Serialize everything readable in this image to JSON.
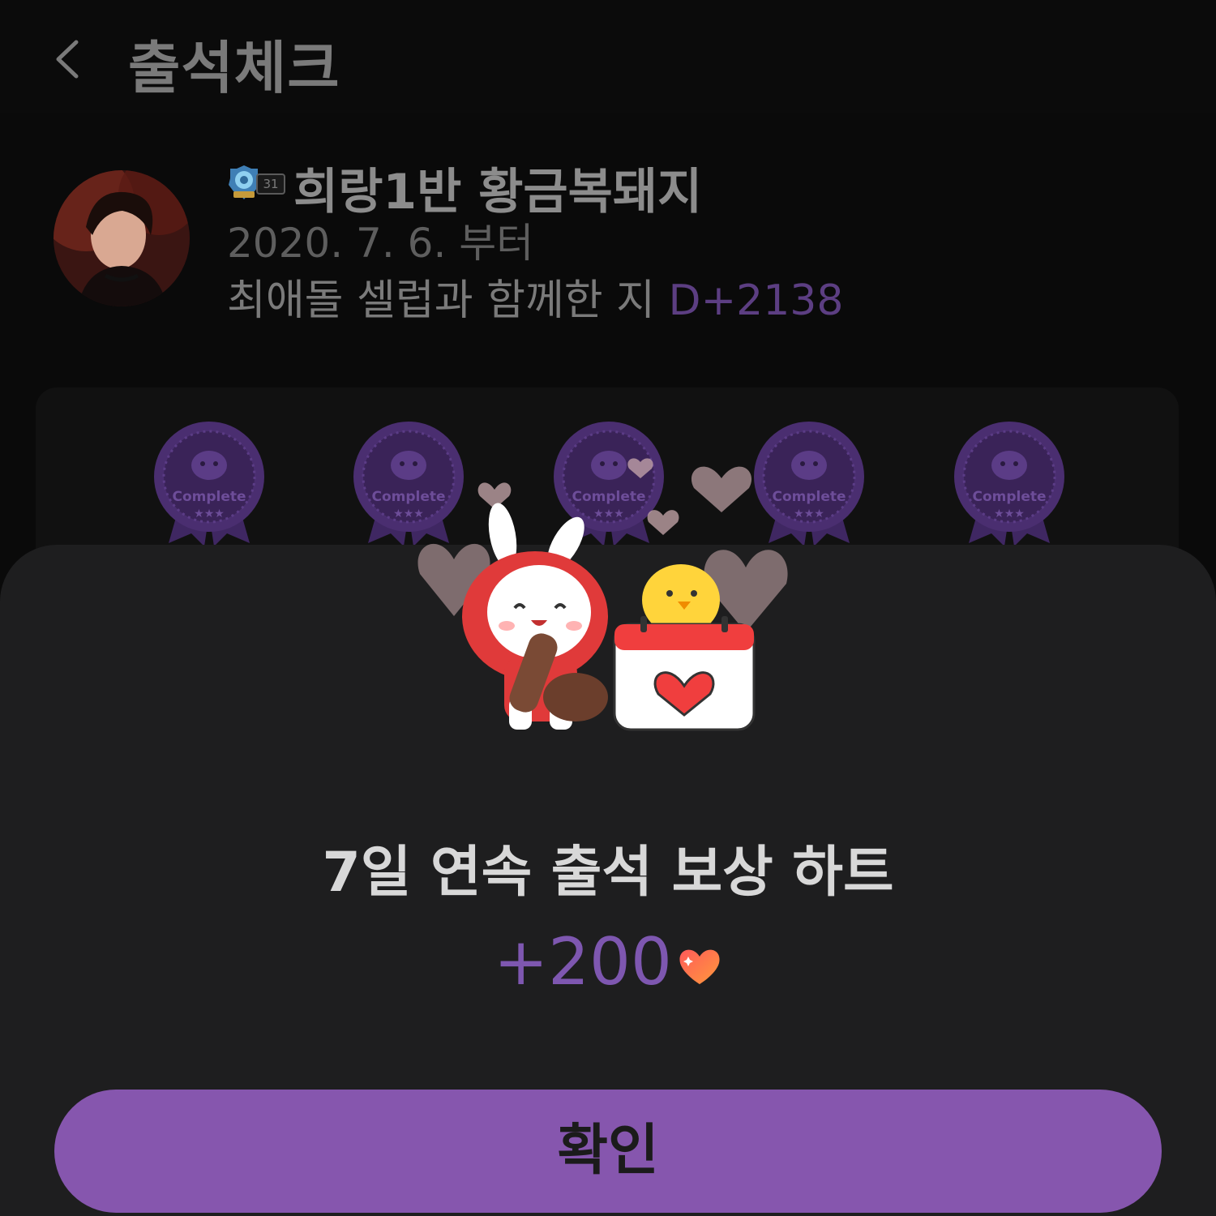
{
  "header": {
    "title": "출석체크",
    "back_icon": "chevron-left-icon"
  },
  "profile": {
    "level": "31",
    "nickname": "희랑1반 황금복돼지",
    "since": "2020. 7. 6. 부터",
    "together_text": "최애돌 셀럽과 함께한 지 ",
    "dday": "D+2138"
  },
  "badges": [
    {
      "label": "Complete"
    },
    {
      "label": "Complete"
    },
    {
      "label": "Complete"
    },
    {
      "label": "Complete"
    },
    {
      "label": "Complete"
    }
  ],
  "reward": {
    "title": "7일 연속 출석 보상 하트",
    "amount": "+200",
    "icon": "heart-icon"
  },
  "confirm_button": {
    "label": "확인"
  },
  "colors": {
    "accent": "#8656ae",
    "dday": "#5c3e82",
    "amount": "#7e57b0",
    "badge": "#4a2e70",
    "sheet": "#1e1e1f"
  }
}
